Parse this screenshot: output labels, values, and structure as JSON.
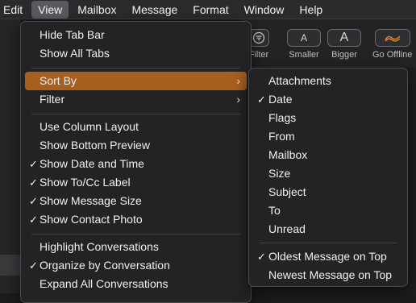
{
  "menubar": {
    "items": [
      "Edit",
      "View",
      "Mailbox",
      "Message",
      "Format",
      "Window",
      "Help"
    ]
  },
  "toolbar": {
    "filter_label": "Filter",
    "smaller_label": "Smaller",
    "smaller_glyph": "A",
    "bigger_label": "Bigger",
    "bigger_glyph": "A",
    "offline_label": "Go Offline"
  },
  "view_menu": {
    "items": [
      {
        "label": "Hide Tab Bar",
        "checked": false
      },
      {
        "label": "Show All Tabs",
        "checked": false
      },
      {
        "label": "Sort By",
        "submenu": true,
        "highlighted": true
      },
      {
        "label": "Filter",
        "submenu": true
      },
      {
        "label": "Use Column Layout",
        "checked": false
      },
      {
        "label": "Show Bottom Preview",
        "checked": false
      },
      {
        "label": "Show Date and Time",
        "checked": true
      },
      {
        "label": "Show To/Cc Label",
        "checked": true
      },
      {
        "label": "Show Message Size",
        "checked": true
      },
      {
        "label": "Show Contact Photo",
        "checked": true
      },
      {
        "label": "Highlight Conversations",
        "checked": false
      },
      {
        "label": "Organize by Conversation",
        "checked": true
      },
      {
        "label": "Expand All Conversations",
        "checked": false
      }
    ]
  },
  "sort_menu": {
    "items": [
      {
        "label": "Attachments",
        "checked": false
      },
      {
        "label": "Date",
        "checked": true
      },
      {
        "label": "Flags",
        "checked": false
      },
      {
        "label": "From",
        "checked": false
      },
      {
        "label": "Mailbox",
        "checked": false
      },
      {
        "label": "Size",
        "checked": false
      },
      {
        "label": "Subject",
        "checked": false
      },
      {
        "label": "To",
        "checked": false
      },
      {
        "label": "Unread",
        "checked": false
      },
      {
        "label": "Oldest Message on Top",
        "checked": true
      },
      {
        "label": "Newest Message on Top",
        "checked": false
      }
    ]
  },
  "glyphs": {
    "check": "✓",
    "submenu_arrow": "›"
  },
  "colors": {
    "highlight": "#a65f1f",
    "menubar_active": "#5a5a5e"
  }
}
